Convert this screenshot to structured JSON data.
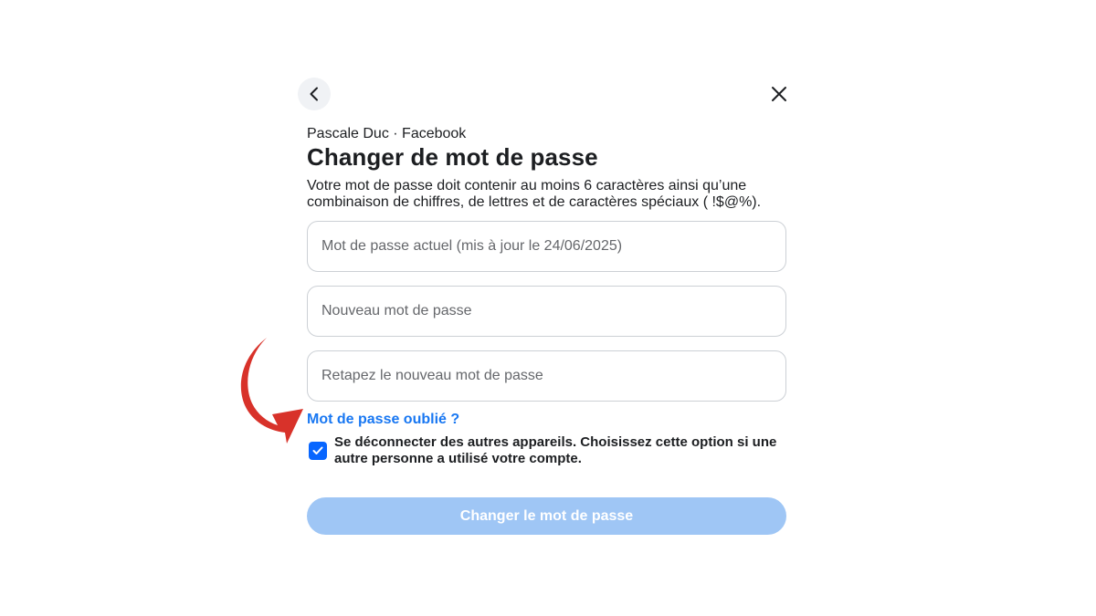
{
  "header": {
    "back_icon": "chevron-left-icon",
    "close_icon": "close-icon"
  },
  "account_line": "Pascale Duc · Facebook",
  "title": "Changer de mot de passe",
  "description": "Votre mot de passe doit contenir au moins 6 caractères ainsi qu’une combinaison de chiffres, de lettres et de caractères spéciaux ( !$@%).",
  "fields": {
    "current_password": {
      "placeholder": "Mot de passe actuel (mis à jour le 24/06/2025)",
      "value": ""
    },
    "new_password": {
      "placeholder": "Nouveau mot de passe",
      "value": ""
    },
    "confirm_password": {
      "placeholder": "Retapez le nouveau mot de passe",
      "value": ""
    }
  },
  "forgot_link": "Mot de passe oublié ?",
  "logout_option": {
    "checked": true,
    "label": "Se déconnecter des autres appareils. Choisissez cette option si une autre personne a utilisé votre compte."
  },
  "submit_label": "Changer le mot de passe",
  "colors": {
    "link": "#1877f2",
    "checkbox": "#0866ff",
    "button_disabled": "#9fc6f5",
    "annotation_arrow": "#d8322a"
  }
}
